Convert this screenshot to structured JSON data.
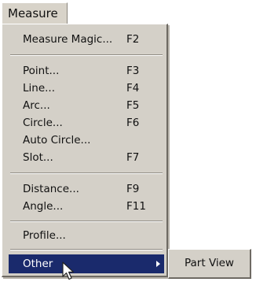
{
  "menubar": {
    "measure_label": "Measure"
  },
  "menu": {
    "items": [
      {
        "label": "Measure Magic...",
        "shortcut": "F2"
      },
      {
        "label": "Point...",
        "shortcut": "F3"
      },
      {
        "label": "Line...",
        "shortcut": "F4"
      },
      {
        "label": "Arc...",
        "shortcut": "F5"
      },
      {
        "label": "Circle...",
        "shortcut": "F6"
      },
      {
        "label": "Auto Circle...",
        "shortcut": ""
      },
      {
        "label": "Slot...",
        "shortcut": "F7"
      },
      {
        "label": "Distance...",
        "shortcut": "F9"
      },
      {
        "label": "Angle...",
        "shortcut": "F11"
      },
      {
        "label": "Profile...",
        "shortcut": ""
      },
      {
        "label": "Other",
        "shortcut": ""
      }
    ],
    "highlight_color": "#1a2a6c",
    "background_color": "#d4d0c8"
  },
  "submenu": {
    "items": [
      {
        "label": "Part View"
      }
    ]
  },
  "icons": {
    "submenu_arrow": "chevron-right-icon",
    "pointer": "mouse-cursor-icon"
  }
}
